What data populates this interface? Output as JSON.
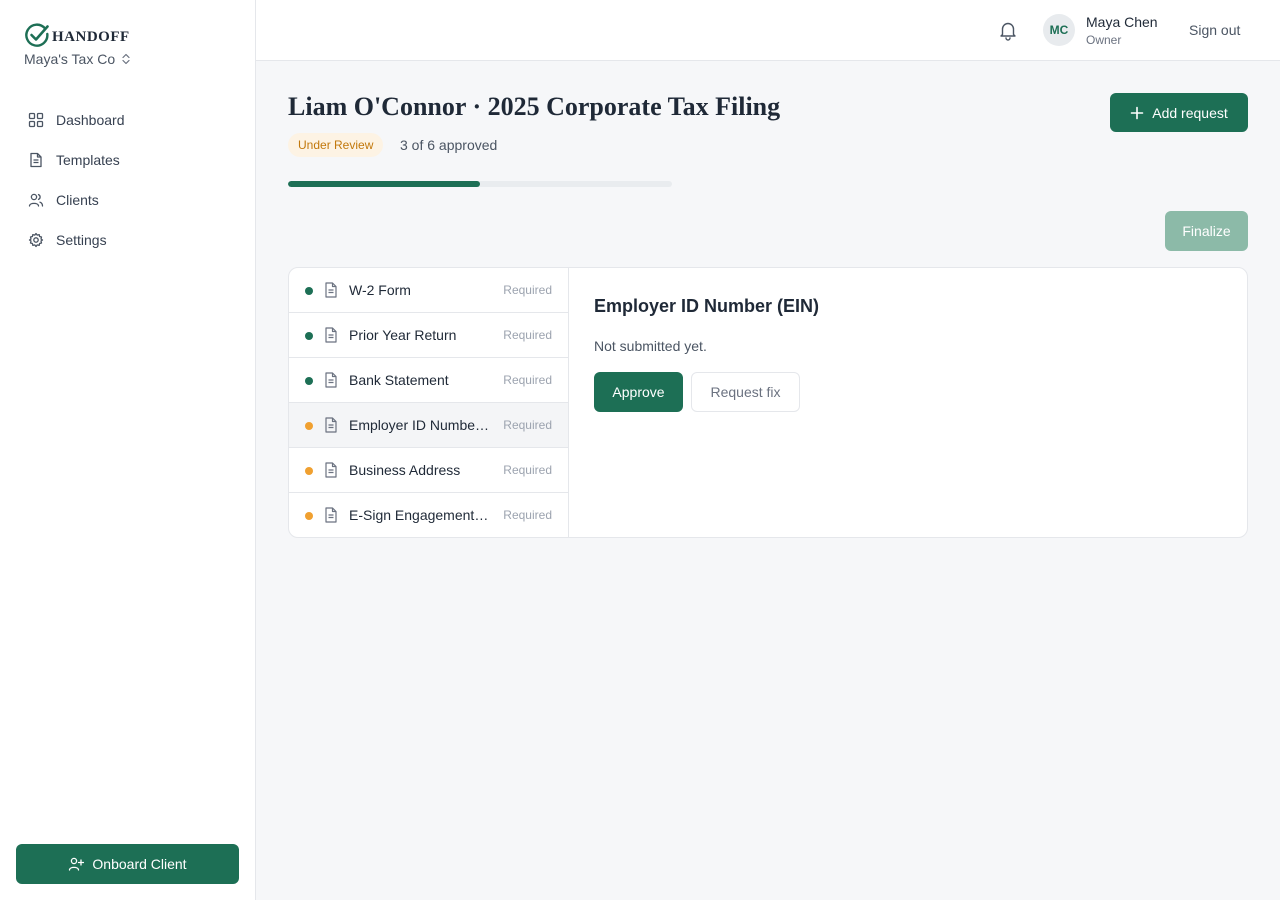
{
  "brand": {
    "name": "HANDOFF",
    "org": "Maya's Tax Co"
  },
  "sidebar": {
    "items": [
      {
        "label": "Dashboard",
        "icon": "grid-icon"
      },
      {
        "label": "Templates",
        "icon": "document-icon"
      },
      {
        "label": "Clients",
        "icon": "users-icon"
      },
      {
        "label": "Settings",
        "icon": "gear-icon"
      }
    ],
    "onboard_label": "Onboard Client"
  },
  "topbar": {
    "avatar_initials": "MC",
    "user_name": "Maya Chen",
    "user_role": "Owner",
    "signout_label": "Sign out"
  },
  "header": {
    "title": "Liam O'Connor · 2025 Corporate Tax Filing",
    "status": "Under Review",
    "approved_text": "3 of 6 approved",
    "progress_fraction": 0.5,
    "add_request_label": "Add request",
    "finalize_label": "Finalize"
  },
  "colors": {
    "accent": "#1d6f55",
    "status_done": "#1d6f55",
    "status_pending": "#f0a030"
  },
  "requests": [
    {
      "name": "W-2 Form",
      "tag": "Required",
      "status": "approved"
    },
    {
      "name": "Prior Year Return",
      "tag": "Required",
      "status": "approved"
    },
    {
      "name": "Bank Statement",
      "tag": "Required",
      "status": "approved"
    },
    {
      "name": "Employer ID Number (EIN)",
      "tag": "Required",
      "status": "pending",
      "active": true
    },
    {
      "name": "Business Address",
      "tag": "Required",
      "status": "pending"
    },
    {
      "name": "E-Sign Engagement Letter",
      "tag": "Required",
      "status": "pending"
    }
  ],
  "detail": {
    "title": "Employer ID Number (EIN)",
    "status_text": "Not submitted yet.",
    "approve_label": "Approve",
    "fix_label": "Request fix"
  }
}
